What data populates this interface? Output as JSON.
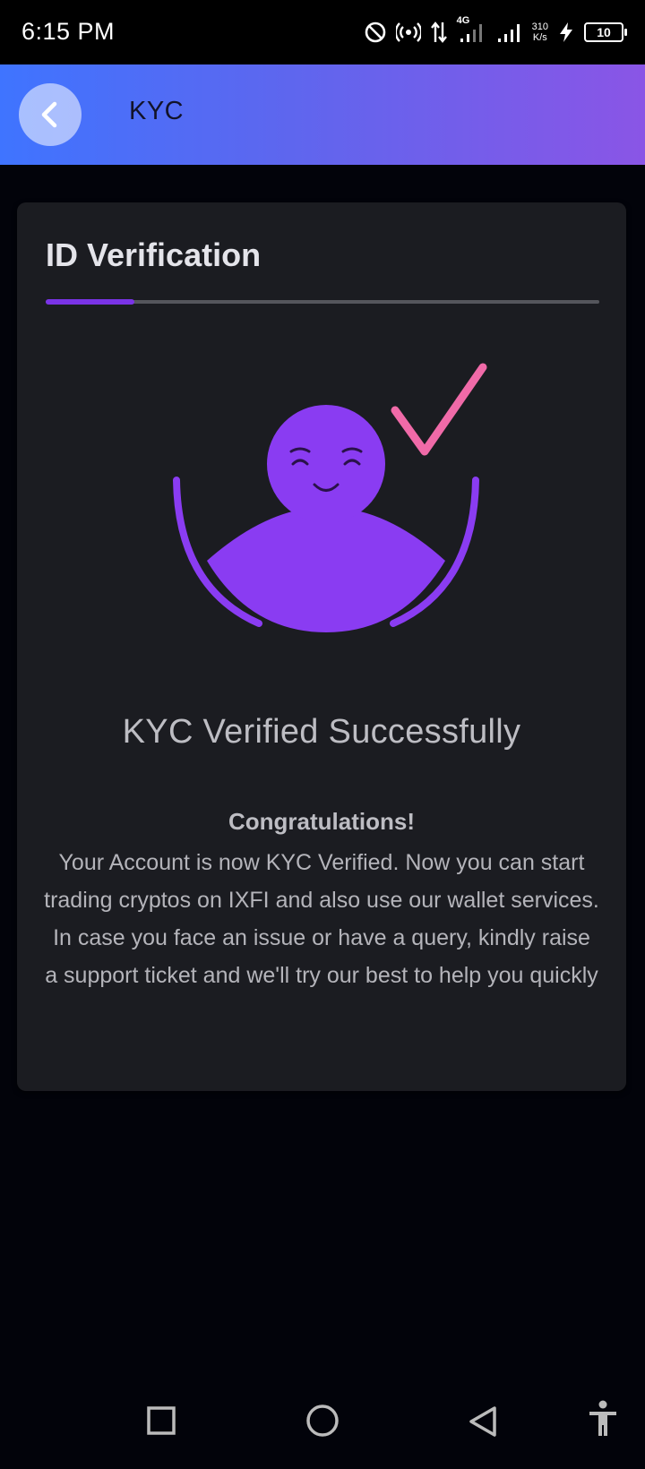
{
  "status_bar": {
    "time": "6:15 PM",
    "network_type": "4G",
    "speed_value": "310",
    "speed_unit": "K/s",
    "battery": "10",
    "icons": [
      "do-not-disturb-icon",
      "hotspot-icon",
      "data-transfer-icon",
      "signal-icon",
      "signal-icon",
      "charging-icon",
      "battery-icon"
    ]
  },
  "header": {
    "title": "KYC",
    "back_icon": "chevron-left-icon",
    "gradient": [
      "#3f74ff",
      "#8a55e6"
    ]
  },
  "card": {
    "title": "ID Verification",
    "progress": 0.16,
    "heading": "KYC Verified Successfully",
    "congrats": "Congratulations!",
    "message": "Your Account is now KYC Verified. Now you can start trading cryptos on IXFI and also use our wallet services. In case you face an issue or have a query, kindly raise a support ticket and we'll try our best to help you quickly"
  },
  "colors": {
    "accent": "#7a33e6",
    "figure": "#8a3cf2",
    "check": "#f06aa8",
    "card_bg": "#1b1c21",
    "page_bg": "#02030a"
  },
  "nav_bar": {
    "buttons": [
      "recent-apps-icon",
      "home-icon",
      "back-icon",
      "accessibility-icon"
    ]
  }
}
